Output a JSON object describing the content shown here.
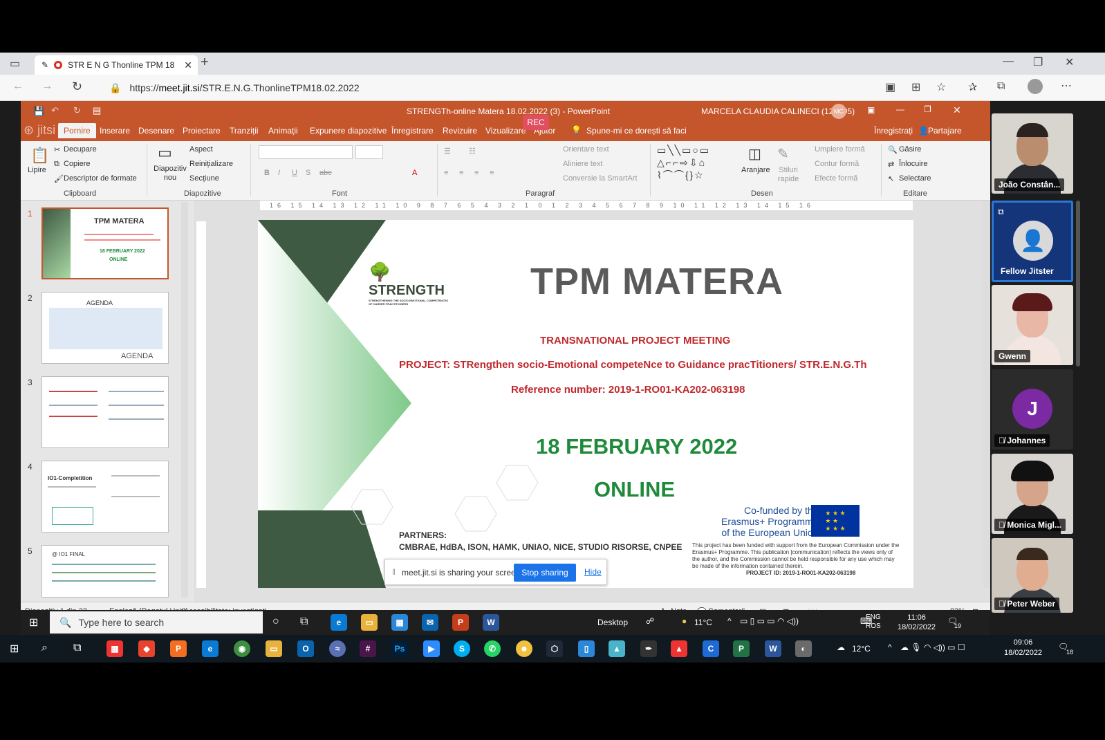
{
  "browser": {
    "tab_title": "STR E N G Thonline TPM 18",
    "url_prefix": "https://",
    "url_host": "meet.jit.si",
    "url_path": "/STR.E.N.G.ThonlineTPM18.02.2022"
  },
  "rec_badge": "REC",
  "powerpoint": {
    "window_title": "STRENGTh-online Matera 18.02.2022 (3)  -  PowerPoint",
    "user": "MARCELA CLAUDIA CALINECI (122395)",
    "user_initials": "MC",
    "tabs": [
      "Pornire",
      "Inserare",
      "Desenare",
      "Proiectare",
      "Tranziții",
      "Animații",
      "Expunere diapozitive",
      "Înregistrare",
      "Revizuire",
      "Vizualizare",
      "Ajutor"
    ],
    "tell_me": "Spune-mi ce dorești să faci",
    "sign_in": "Înregistrați",
    "share": "Partajare",
    "ribbon": {
      "clipboard": {
        "paste": "Lipire",
        "cut": "Decupare",
        "copy": "Copiere",
        "format_painter": "Descriptor de formate",
        "label": "Clipboard"
      },
      "slides": {
        "new_slide": "Diapozitiv nou",
        "layout": "Aspect",
        "reset": "Reinițializare",
        "section": "Secțiune",
        "label": "Diapozitive"
      },
      "font": {
        "label": "Font"
      },
      "paragraph": {
        "text_direction": "Orientare text",
        "align_text": "Aliniere text",
        "smartart": "Conversie la SmartArt",
        "label": "Paragraf"
      },
      "drawing": {
        "arrange": "Aranjare",
        "styles": "Stiluri rapide",
        "fill": "Umplere formă",
        "outline": "Contur formă",
        "effects": "Efecte formă",
        "label": "Desen"
      },
      "editing": {
        "find": "Găsire",
        "replace": "Înlocuire",
        "select": "Selectare",
        "label": "Editare"
      }
    },
    "thumbnails": [
      {
        "num": "1",
        "title": "TPM MATERA",
        "sub": "18 FEBRUARY 2022",
        "sub2": "ONLINE"
      },
      {
        "num": "2",
        "title": "AGENDA",
        "sub": "AGENDA"
      },
      {
        "num": "3",
        "title": ""
      },
      {
        "num": "4",
        "title": "IO1-Completition"
      },
      {
        "num": "5",
        "title": "@ IO1 FINAL"
      }
    ],
    "slide": {
      "logo": "STRENGTH",
      "logo_sub": "STRENGTHENING THE SOCIO-EMOTIONAL COMPETENCES OF CAREER PRACTITIONERS",
      "title": "TPM MATERA",
      "line1": "TRANSNATIONAL PROJECT MEETING",
      "line2": "PROJECT: STRengthen socio-Emotional competeNce to Guidance pracTitioners/ STR.E.N.G.Th",
      "line3": "Reference number: 2019-1-RO01-KA202-063198",
      "date": "18 FEBRUARY 2022",
      "online": "ONLINE",
      "partners_label": "PARTNERS:",
      "partners": "CMBRAE, HdBA, ISON, HAMK, UNIAO, NICE, STUDIO RISORSE, CNPEE",
      "cofunded_1": "Co-funded by the",
      "cofunded_2": "Erasmus+ Programme",
      "cofunded_3": "of the European Union",
      "disclaimer": "This project has been funded with support from the European Commission under the Erasmus+ Programme. This publication [communication] reflects the views only of the author, and the Commission cannot be held responsible for any use which may be made of the information contained therein.",
      "project_id": "PROJECT ID: 2019-1-RO01-KA202-063198"
    },
    "status": {
      "slide_count": "Diapozitiv 1 din 32",
      "language": "Engleză (Regatul Unit)",
      "accessibility": "Accesibilitate: investigați",
      "notes": "Note",
      "comments": "Comentarii",
      "zoom": "83%"
    }
  },
  "share_banner": {
    "text": "meet.jit.si is sharing your screen.",
    "stop": "Stop sharing",
    "hide": "Hide"
  },
  "remote_taskbar": {
    "search": "Type here to search",
    "desktop": "Desktop",
    "temp": "11°C",
    "lang1": "ENG",
    "lang2": "ROS",
    "time": "11:06",
    "date": "18/02/2022",
    "notif": "19"
  },
  "participants": [
    {
      "name": "João Constân...",
      "type": "video",
      "muted": false
    },
    {
      "name": "Fellow Jitster",
      "type": "avatar",
      "muted": false
    },
    {
      "name": "Gwenn",
      "type": "video",
      "muted": false
    },
    {
      "name": "Johannes",
      "type": "initial",
      "initial": "J",
      "muted": true
    },
    {
      "name": "Monica Migl...",
      "type": "video",
      "muted": true
    },
    {
      "name": "Peter Weber",
      "type": "video",
      "muted": true
    }
  ],
  "local_taskbar": {
    "temp": "12°C",
    "time": "09:06",
    "date": "18/02/2022",
    "notif": "18"
  },
  "colors": {
    "ppt_accent": "#c5552b",
    "slide_red": "#c0282d",
    "slide_green": "#1f8a3a",
    "jitsi_blue": "#1a73e8"
  }
}
